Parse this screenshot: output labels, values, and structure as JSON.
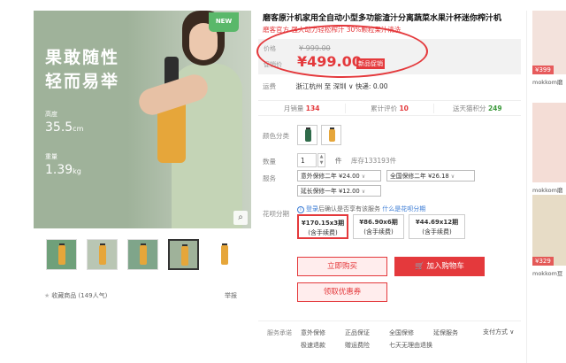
{
  "gallery": {
    "badge": "NEW",
    "slogan_line1": "果敢随性",
    "slogan_line2": "轻而易举",
    "spec1_label": "高度",
    "spec1_value": "35.5",
    "spec1_unit": "cm",
    "spec2_label": "重量",
    "spec2_value": "1.39",
    "spec2_unit": "kg",
    "zoom_icon": "magnifier-icon",
    "thumb_count": 5,
    "thumb_labels": [
      "",
      "",
      "",
      "",
      ""
    ]
  },
  "footer_left": {
    "favorite": "收藏商品",
    "popularity": "(149人气)",
    "report": "举报"
  },
  "product": {
    "title": "磨客原汁机家用全自动小型多功能渣汁分离蔬菜水果汁杯迷你榨汁机",
    "subtitle": "磨客官方 强大动力轻松榨汁 30%颗粒果汁清洗",
    "price_label": "价格",
    "original_price": "¥ 999.00",
    "promo_price_label": "促销价",
    "current_price": "¥499.00",
    "promo_tag": "新品促销",
    "shipping_label": "运费",
    "shipping_value": "浙江杭州 至 深圳 ∨ 快递: 0.00"
  },
  "stats": {
    "monthly_sales_label": "月销量",
    "monthly_sales": "134",
    "reviews_label": "累计评价",
    "reviews": "10",
    "points_label": "送天猫积分",
    "points": "249"
  },
  "options": {
    "color_label": "颜色分类",
    "colors": [
      "#2f6b4a",
      "#e6a63a"
    ],
    "qty_label": "数量",
    "qty_value": "1",
    "qty_unit": "件",
    "stock": "库存133193件",
    "service_label": "服务",
    "services": [
      "意外保修二年 ¥24.00",
      "全国保修二年 ¥26.18",
      "延长保修一年 ¥12.00"
    ],
    "huabei_label": "花呗分期",
    "huabei_info_prefix": "登录",
    "huabei_info_middle": "后确认是否享有该服务",
    "huabei_info_link": "什么是花呗分期",
    "plans": [
      {
        "amount": "¥170.15x3期",
        "note": "(含手续费)"
      },
      {
        "amount": "¥86.90x6期",
        "note": "(含手续费)"
      },
      {
        "amount": "¥44.69x12期",
        "note": "(含手续费)"
      }
    ]
  },
  "actions": {
    "buy_now": "立即购买",
    "add_cart": "加入购物车",
    "coupon": "领取优惠券"
  },
  "promise": {
    "label": "服务承诺",
    "items": [
      "意外保修",
      "正品保证",
      "全国保修",
      "延保服务",
      "极速退款",
      "赠运费险",
      "七天无理由退换"
    ],
    "pay_label": "支付方式"
  },
  "sidebar": {
    "items": [
      {
        "price": "¥399",
        "name": "mokkom磨"
      },
      {
        "price": "",
        "name": "mokkom磨"
      },
      {
        "price": "¥329",
        "name": "mokkom豆"
      }
    ]
  },
  "colors": {
    "accent": "#e4393c",
    "image_bg": "#9fb29a",
    "green_stat": "#3c9a3c"
  }
}
